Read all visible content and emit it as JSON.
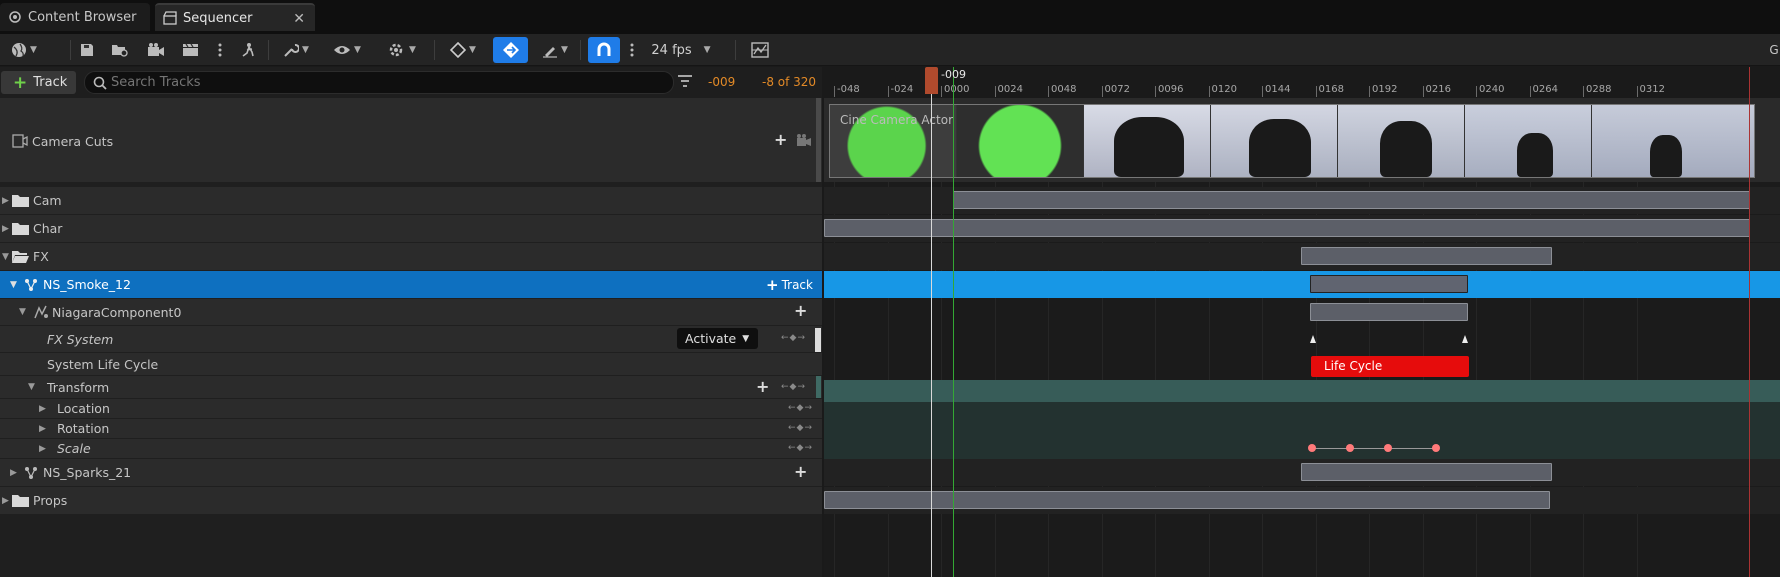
{
  "tabs": [
    {
      "label": "Content Browser"
    },
    {
      "label": "Sequencer"
    }
  ],
  "toolbar": {
    "fps": "24 fps",
    "right_letter": "G"
  },
  "tracks_header": {
    "add_track_label": "Track",
    "search_placeholder": "Search Tracks",
    "current_frame": "-009",
    "frame_count": "-8 of 320"
  },
  "rows": {
    "camera_cuts": "Camera Cuts",
    "cam": "Cam",
    "char": "Char",
    "fx": "FX",
    "ns_smoke": "NS_Smoke_12",
    "ns_smoke_track_button": "Track",
    "niagara": "NiagaraComponent0",
    "fx_system": "FX System",
    "fx_system_dropdown": "Activate",
    "system_life_cycle": "System Life Cycle",
    "transform": "Transform",
    "location": "Location",
    "rotation": "Rotation",
    "scale": "Scale",
    "ns_sparks": "NS_Sparks_21",
    "props": "Props"
  },
  "timeline": {
    "playhead_label": "-009",
    "ticks": [
      "-048",
      "-024",
      "0000",
      "0024",
      "0048",
      "0072",
      "0096",
      "0120",
      "0144",
      "0168",
      "0192",
      "0216",
      "0240",
      "0264",
      "0288",
      "0312"
    ],
    "camera_thumb_label": "Cine Camera Actor",
    "life_cycle_label": "Life Cycle"
  },
  "colors": {
    "selected_row": "#0e70c0",
    "selected_timeline": "#1797e6",
    "transform_band": "#375c58",
    "life_cycle": "#e60c0c",
    "key_dot": "#ff7a7a",
    "frame_text": "#e38a27"
  }
}
